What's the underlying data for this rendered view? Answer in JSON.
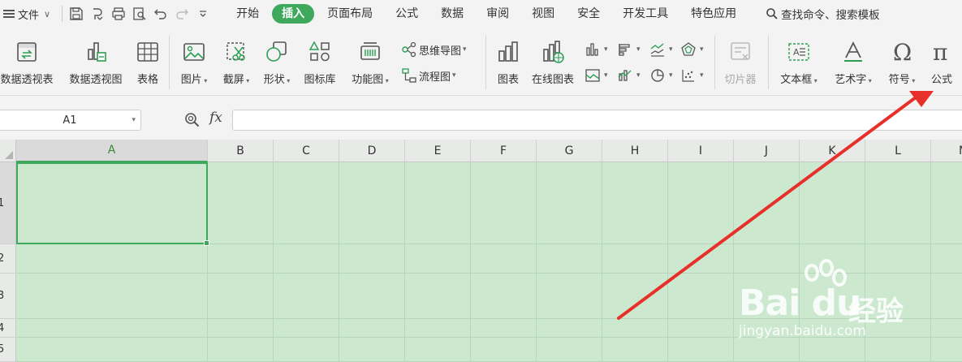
{
  "menubar": {
    "file_label": "文件",
    "tabs": [
      {
        "label": "开始",
        "active": false
      },
      {
        "label": "插入",
        "active": true
      },
      {
        "label": "页面布局",
        "active": false
      },
      {
        "label": "公式",
        "active": false
      },
      {
        "label": "数据",
        "active": false
      },
      {
        "label": "审阅",
        "active": false
      },
      {
        "label": "视图",
        "active": false
      },
      {
        "label": "安全",
        "active": false
      },
      {
        "label": "开发工具",
        "active": false
      },
      {
        "label": "特色应用",
        "active": false
      }
    ],
    "search_label": "查找命令、搜索模板"
  },
  "ribbon": {
    "pivot_table": "数据透视表",
    "pivot_chart": "数据透视图",
    "table": "表格",
    "picture": "图片",
    "screenshot": "截屏",
    "shape": "形状",
    "icon_lib": "图标库",
    "func_chart": "功能图",
    "mind_map": "思维导图",
    "flow_chart": "流程图",
    "chart": "图表",
    "online_chart": "在线图表",
    "slicer": "切片器",
    "text_box": "文本框",
    "word_art": "艺术字",
    "symbol": "符号",
    "formula": "公式"
  },
  "formula_bar": {
    "name_box": "A1",
    "fx": "fx",
    "value": ""
  },
  "grid": {
    "columns": [
      "A",
      "B",
      "C",
      "D",
      "E",
      "F",
      "G",
      "H",
      "I",
      "J",
      "K",
      "L",
      "M"
    ],
    "rows": [
      "1",
      "2",
      "3",
      "4",
      "5"
    ],
    "selected_cell": "A1"
  },
  "watermark": {
    "logo": "Bai du",
    "cn": "经验",
    "url": "jingyan.baidu.com"
  },
  "colors": {
    "accent": "#3ea95c",
    "cell_bg": "#cce8cf",
    "arrow": "#e8302a"
  }
}
